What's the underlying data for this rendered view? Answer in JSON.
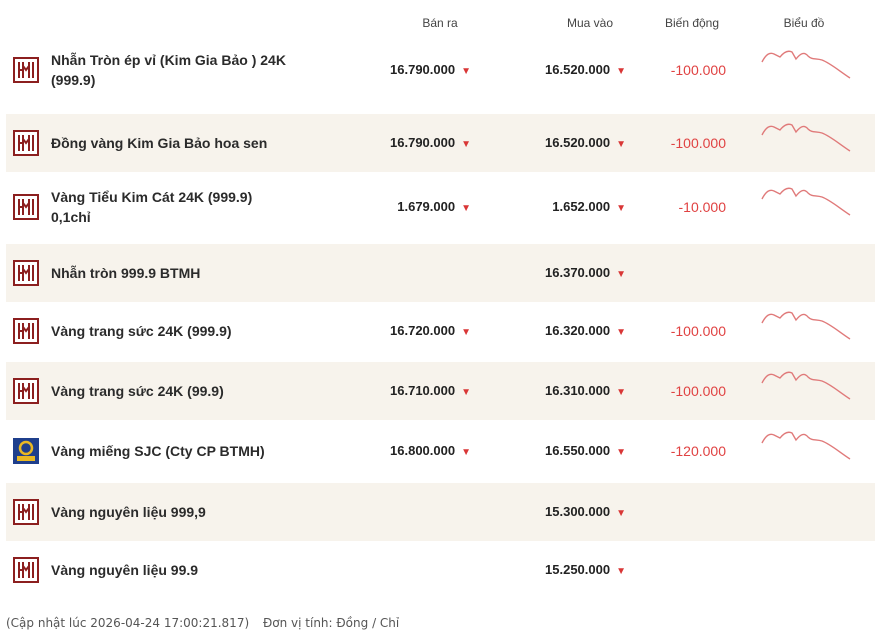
{
  "header": {
    "sell_label": "Bán ra",
    "buy_label": "Mua vào",
    "change_label": "Biến động",
    "chart_label": "Biểu đồ"
  },
  "rows": [
    {
      "name_line1": "Nhẫn Tròn ép vỉ (Kim Gia Bảo ) 24K",
      "name_line2": "(999.9)",
      "sell": "16.790.000",
      "buy": "16.520.000",
      "change": "-100.000",
      "logo": "bao-tin-minh-chau-logo",
      "has_chart": true
    },
    {
      "name_line1": "Đồng vàng Kim Gia Bảo hoa sen",
      "name_line2": "",
      "sell": "16.790.000",
      "buy": "16.520.000",
      "change": "-100.000",
      "logo": "bao-tin-minh-chau-logo",
      "has_chart": true
    },
    {
      "name_line1": "Vàng Tiểu Kim Cát 24K (999.9)",
      "name_line2": "0,1chỉ",
      "sell": "1.679.000",
      "buy": "1.652.000",
      "change": "-10.000",
      "logo": "bao-tin-minh-chau-logo",
      "has_chart": true
    },
    {
      "name_line1": "Nhẫn tròn 999.9 BTMH",
      "name_line2": "",
      "sell": "",
      "buy": "16.370.000",
      "change": "",
      "logo": "bao-tin-minh-chau-logo",
      "has_chart": false
    },
    {
      "name_line1": "Vàng trang sức 24K (999.9)",
      "name_line2": "",
      "sell": "16.720.000",
      "buy": "16.320.000",
      "change": "-100.000",
      "logo": "bao-tin-minh-chau-logo",
      "has_chart": true
    },
    {
      "name_line1": "Vàng trang sức 24K (99.9)",
      "name_line2": "",
      "sell": "16.710.000",
      "buy": "16.310.000",
      "change": "-100.000",
      "logo": "bao-tin-minh-chau-logo",
      "has_chart": true
    },
    {
      "name_line1": "Vàng miếng SJC (Cty CP BTMH)",
      "name_line2": "",
      "sell": "16.800.000",
      "buy": "16.550.000",
      "change": "-120.000",
      "logo": "sjc-logo",
      "has_chart": true
    },
    {
      "name_line1": "Vàng nguyên liệu 999,9",
      "name_line2": "",
      "sell": "",
      "buy": "15.300.000",
      "change": "",
      "logo": "bao-tin-minh-chau-logo",
      "has_chart": false
    },
    {
      "name_line1": "Vàng nguyên liệu 99.9",
      "name_line2": "",
      "sell": "",
      "buy": "15.250.000",
      "change": "",
      "logo": "bao-tin-minh-chau-logo",
      "has_chart": false
    }
  ],
  "footer": {
    "updated": "(Cập nhật lúc 2026-04-24 17:00:21.817)",
    "unit": "Đơn vị tính: Đồng / Chỉ"
  },
  "colors": {
    "down_red": "#e04242",
    "alt_row": "#f7f3ec",
    "logo_red": "#8c1f1f",
    "sjc_blue": "#1f3f8c",
    "sjc_gold": "#e9b823"
  }
}
